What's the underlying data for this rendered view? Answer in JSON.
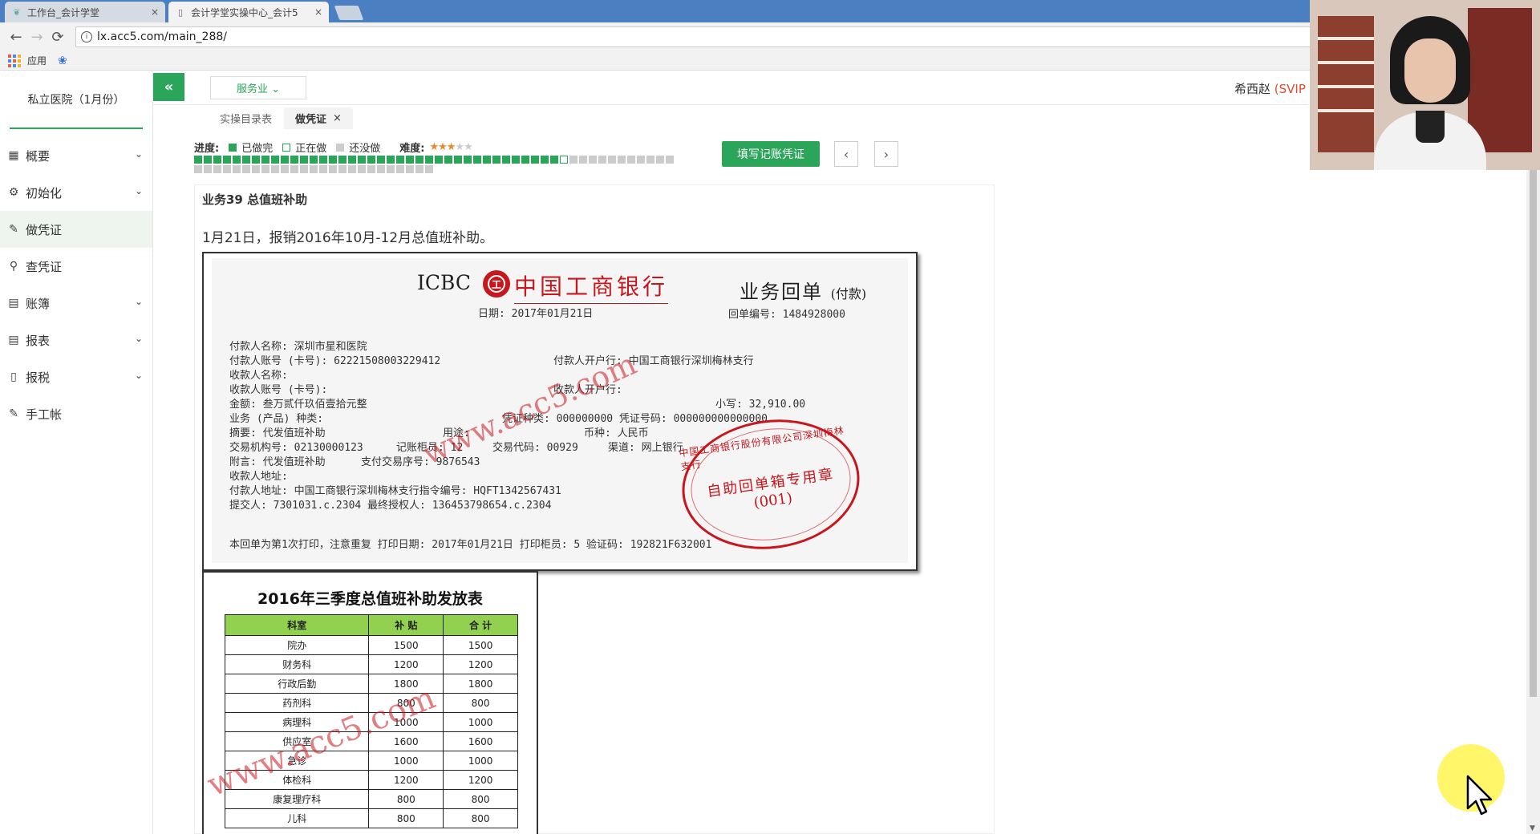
{
  "browser": {
    "tabs": [
      {
        "label": "工作台_会计学堂",
        "close": "×"
      },
      {
        "label": "会计学堂实操中心_会计5",
        "close": "×"
      }
    ],
    "nav": {
      "back": "←",
      "forward": "→",
      "reload": "⟳"
    },
    "url": "lx.acc5.com/main_288/",
    "bookmarks": {
      "apps_label": "应用"
    }
  },
  "sidebar": {
    "company": "私立医院（1月份）",
    "items": [
      {
        "label": "概要",
        "icon": "grid-icon",
        "glyph": "▦",
        "chev": "⌄"
      },
      {
        "label": "初始化",
        "icon": "gear-icon",
        "glyph": "⚙",
        "chev": "⌄"
      },
      {
        "label": "做凭证",
        "icon": "pen-icon",
        "glyph": "✎",
        "chev": ""
      },
      {
        "label": "查凭证",
        "icon": "search-icon",
        "glyph": "⚲",
        "chev": ""
      },
      {
        "label": "账簿",
        "icon": "book-icon",
        "glyph": "▤",
        "chev": "⌄"
      },
      {
        "label": "报表",
        "icon": "report-icon",
        "glyph": "▤",
        "chev": "⌄"
      },
      {
        "label": "报税",
        "icon": "file-icon",
        "glyph": "▯",
        "chev": "⌄"
      },
      {
        "label": "手工帐",
        "icon": "pen-icon",
        "glyph": "✎",
        "chev": ""
      }
    ]
  },
  "header": {
    "collapse_glyph": "«",
    "industry": "服务业 ⌄",
    "user": "希西赵",
    "vip": "(SVIP"
  },
  "subtabs": {
    "catalog": "实操目录表",
    "current": "做凭证",
    "close": "×"
  },
  "progress": {
    "label": "进度:",
    "done_label": "已做完",
    "doing_label": "正在做",
    "todo_label": "还没做",
    "difficulty_label": "难度:",
    "difficulty_stars": 3,
    "difficulty_max": 5,
    "total_cells": 75,
    "done_cells": 38,
    "doing_index": 38
  },
  "actions": {
    "fill_voucher": "填写记账凭证",
    "prev": "‹",
    "next": "›"
  },
  "task": {
    "title": "业务39 总值班补助",
    "description": "1月21日，报销2016年10月-12月总值班补助。"
  },
  "receipt": {
    "icbc": "ICBC",
    "logo_char": "工",
    "bank": "中国工商银行",
    "title": "业务回单",
    "title_note": "(付款)",
    "date": "日期: 2017年01月21日",
    "number": "回单编号: 1484928000",
    "lines": [
      "付款人名称: 深圳市星和医院",
      "付款人账号 (卡号): 62221508003229412",
      "收款人名称:",
      "收款人账号 (卡号):",
      "金额: 叁万贰仟玖佰壹拾元整",
      "业务 (产品) 种类:",
      "摘要: 代发值班补助",
      "交易机构号: 02130000123",
      "附言: 代发值班补助",
      "收款人地址:",
      "付款人地址: 中国工商银行深圳梅林支行指令编号: HQFT1342567431",
      "提交人: 7301031.c.2304 最终授权人: 136453798654.c.2304"
    ],
    "payer_bank": "付款人开户行: 中国工商银行深圳梅林支行",
    "payee_bank": "收款人开户行:",
    "small": "小写: 32,910.00",
    "voucher": "凭证种类: 000000000 凭证号码: 000000000000000",
    "purpose": "用途:",
    "currency": "币种: 人民币",
    "teller": "记账柜员: 12",
    "trade_code": "交易代码: 00929",
    "channel": "渠道: 网上银行",
    "serial": "支付交易序号: 9876543",
    "footer": "本回单为第1次打印，注意重复  打印日期: 2017年01月21日  打印柜员: 5  验证码: 192821F632001",
    "stamp": {
      "ring_text": "中国工商银行股份有限公司深圳梅林支行",
      "line1": "自助回单箱专用章",
      "line2": "(001)"
    },
    "watermark": "www.acc5.com"
  },
  "subsidy_table": {
    "title": "2016年三季度总值班补助发放表",
    "headers": [
      "科室",
      "补 贴",
      "合 计"
    ],
    "rows": [
      [
        "院办",
        "1500",
        "1500"
      ],
      [
        "财务科",
        "1200",
        "1200"
      ],
      [
        "行政后勤",
        "1800",
        "1800"
      ],
      [
        "药剂科",
        "800",
        "800"
      ],
      [
        "病理科",
        "1000",
        "1000"
      ],
      [
        "供应室",
        "1600",
        "1600"
      ],
      [
        "急诊",
        "1000",
        "1000"
      ],
      [
        "体检科",
        "1200",
        "1200"
      ],
      [
        "康复理疗科",
        "800",
        "800"
      ],
      [
        "儿科",
        "800",
        "800"
      ]
    ],
    "header_color": "#92d050",
    "watermark": "www.acc5.com"
  },
  "colors": {
    "accent": "#2aa55a",
    "bank_red": "#c8161d",
    "vip": "#e04a2a"
  }
}
